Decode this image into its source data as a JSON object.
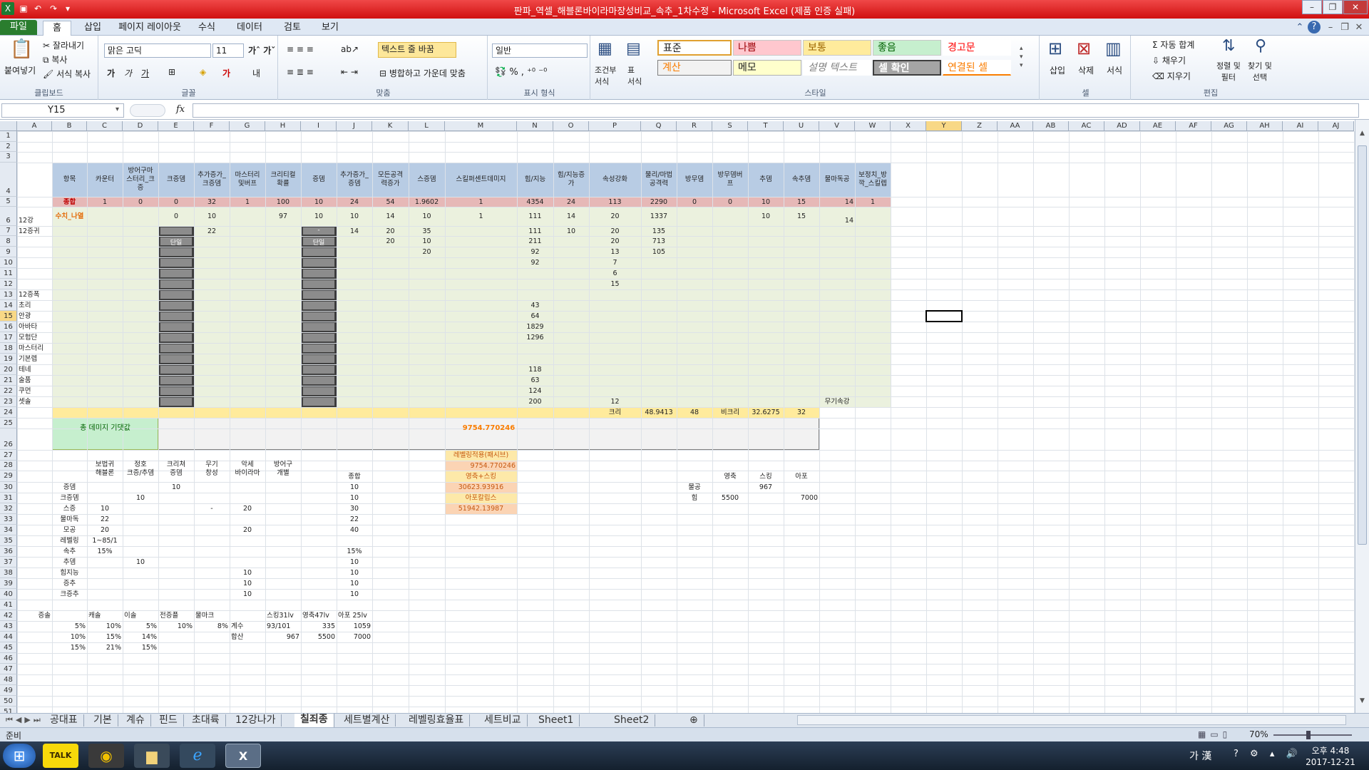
{
  "window": {
    "title": "판파_역셀_해블론바이라마장성비교_속추_1차수정 - Microsoft Excel (제품 인증 실패)"
  },
  "menu": {
    "tabs": [
      "파일",
      "홈",
      "삽입",
      "페이지 레이아웃",
      "수식",
      "데이터",
      "검토",
      "보기"
    ]
  },
  "ribbon": {
    "clipboard": {
      "paste": "붙여넣기",
      "cut": "잘라내기",
      "copy": "복사",
      "format_painter": "서식 복사",
      "label": "클립보드"
    },
    "font": {
      "name": "맑은 고딕",
      "size": "11",
      "label": "글꼴"
    },
    "align": {
      "wrap": "텍스트 줄 바꿈",
      "merge": "병합하고 가운데 맞춤",
      "label": "맞춤"
    },
    "number": {
      "format": "일반",
      "label": "표시 형식"
    },
    "styles": {
      "cond": "조건부\n서식",
      "table": "표\n서식",
      "label": "스타일",
      "cells": [
        "표준",
        "나쁨",
        "보통",
        "좋음",
        "경고문",
        "계산",
        "메모",
        "설명 텍스트",
        "셀 확인",
        "연결된 셀"
      ]
    },
    "cells": {
      "insert": "삽입",
      "delete": "삭제",
      "format": "서식",
      "label": "셀"
    },
    "edit": {
      "autosum": "자동 합계",
      "fill": "채우기",
      "clear": "지우기",
      "sort": "정렬 및\n필터",
      "find": "찾기 및\n선택",
      "label": "편집"
    }
  },
  "formula": {
    "name_box": "Y15",
    "fx": "fx",
    "content": ""
  },
  "columns": [
    "A",
    "B",
    "C",
    "D",
    "E",
    "F",
    "G",
    "H",
    "I",
    "J",
    "K",
    "L",
    "M",
    "N",
    "O",
    "P",
    "Q",
    "R",
    "S",
    "T",
    "U",
    "V",
    "W",
    "X",
    "Y",
    "Z",
    "AA",
    "AB",
    "AC",
    "AD",
    "AE",
    "AF",
    "AG",
    "AH",
    "AI",
    "AJ"
  ],
  "rows": [
    "1",
    "2",
    "3",
    "4",
    "5",
    "6",
    "7",
    "8",
    "9",
    "10",
    "11",
    "12",
    "13",
    "14",
    "15",
    "16",
    "17",
    "18",
    "19",
    "20",
    "21",
    "22",
    "23",
    "24",
    "25",
    "26",
    "27",
    "28",
    "29",
    "30",
    "31",
    "32",
    "33",
    "34",
    "35",
    "36",
    "37",
    "38",
    "39",
    "40",
    "41",
    "42",
    "43",
    "44",
    "45",
    "46",
    "47",
    "48",
    "49",
    "50",
    "51"
  ],
  "grey_labels": {
    "e": "단일",
    "i_top": "-",
    "i": "단일"
  },
  "cells": [
    {
      "c": "B",
      "r": 4,
      "t": "항목"
    },
    {
      "c": "C",
      "r": 4,
      "t": "카운터"
    },
    {
      "c": "D",
      "r": 4,
      "t": "방어구마\n스터리_크\n증"
    },
    {
      "c": "E",
      "r": 4,
      "t": "크증뎀"
    },
    {
      "c": "F",
      "r": 4,
      "t": "추가증가_\n크증뎀"
    },
    {
      "c": "G",
      "r": 4,
      "t": "마스터리\n및버프"
    },
    {
      "c": "H",
      "r": 4,
      "t": "크리티컬\n확률"
    },
    {
      "c": "I",
      "r": 4,
      "t": "증뎀"
    },
    {
      "c": "J",
      "r": 4,
      "t": "추가증가_\n증뎀"
    },
    {
      "c": "K",
      "r": 4,
      "t": "모든공격\n력증가"
    },
    {
      "c": "L",
      "r": 4,
      "t": "스증뎀"
    },
    {
      "c": "M",
      "r": 4,
      "t": "스킬퍼센트데미지"
    },
    {
      "c": "N",
      "r": 4,
      "t": "힘/지능"
    },
    {
      "c": "O",
      "r": 4,
      "t": "힘/지능증\n가"
    },
    {
      "c": "P",
      "r": 4,
      "t": "속성강화"
    },
    {
      "c": "Q",
      "r": 4,
      "t": "물리/마법\n공격력"
    },
    {
      "c": "R",
      "r": 4,
      "t": "방무뎀"
    },
    {
      "c": "S",
      "r": 4,
      "t": "방무뎀버\n프"
    },
    {
      "c": "T",
      "r": 4,
      "t": "추뎀"
    },
    {
      "c": "U",
      "r": 4,
      "t": "속추뎀"
    },
    {
      "c": "V",
      "r": 4,
      "t": "물마독공"
    },
    {
      "c": "W",
      "r": 4,
      "t": "보정치_방\n깍_스킬렙"
    },
    {
      "c": "B",
      "r": 5,
      "t": "종합",
      "cls": "red"
    },
    {
      "c": "C",
      "r": 5,
      "t": "1"
    },
    {
      "c": "D",
      "r": 5,
      "t": "0"
    },
    {
      "c": "E",
      "r": 5,
      "t": "0"
    },
    {
      "c": "F",
      "r": 5,
      "t": "32"
    },
    {
      "c": "G",
      "r": 5,
      "t": "1"
    },
    {
      "c": "H",
      "r": 5,
      "t": "100"
    },
    {
      "c": "I",
      "r": 5,
      "t": "10"
    },
    {
      "c": "J",
      "r": 5,
      "t": "24"
    },
    {
      "c": "K",
      "r": 5,
      "t": "54"
    },
    {
      "c": "L",
      "r": 5,
      "t": "1.9602"
    },
    {
      "c": "M",
      "r": 5,
      "t": "1"
    },
    {
      "c": "N",
      "r": 5,
      "t": "4354"
    },
    {
      "c": "O",
      "r": 5,
      "t": "24"
    },
    {
      "c": "P",
      "r": 5,
      "t": "113"
    },
    {
      "c": "Q",
      "r": 5,
      "t": "2290"
    },
    {
      "c": "R",
      "r": 5,
      "t": "0"
    },
    {
      "c": "S",
      "r": 5,
      "t": "0"
    },
    {
      "c": "T",
      "r": 5,
      "t": "10"
    },
    {
      "c": "U",
      "r": 5,
      "t": "15"
    },
    {
      "c": "V",
      "r": 5,
      "t": "14",
      "a": "r"
    },
    {
      "c": "W",
      "r": 5,
      "t": "1"
    },
    {
      "c": "B",
      "r": 6,
      "t": "수치_나열",
      "cls": "orange"
    },
    {
      "c": "E",
      "r": 6,
      "t": "0"
    },
    {
      "c": "F",
      "r": 6,
      "t": "10"
    },
    {
      "c": "H",
      "r": 6,
      "t": "97"
    },
    {
      "c": "I",
      "r": 6,
      "t": "10"
    },
    {
      "c": "J",
      "r": 6,
      "t": "10"
    },
    {
      "c": "K",
      "r": 6,
      "t": "14"
    },
    {
      "c": "L",
      "r": 6,
      "t": "10"
    },
    {
      "c": "M",
      "r": 6,
      "t": "1"
    },
    {
      "c": "N",
      "r": 6,
      "t": "111"
    },
    {
      "c": "O",
      "r": 6,
      "t": "14"
    },
    {
      "c": "P",
      "r": 6,
      "t": "20"
    },
    {
      "c": "Q",
      "r": 6,
      "t": "1337"
    },
    {
      "c": "T",
      "r": 6,
      "t": "10"
    },
    {
      "c": "U",
      "r": 6,
      "t": "15"
    },
    {
      "c": "A",
      "r": 6,
      "t": "12강",
      "a": "l",
      "low": true
    },
    {
      "c": "V",
      "r": 6,
      "t": "14",
      "a": "r",
      "low": true
    },
    {
      "c": "A",
      "r": 7,
      "t": "12증귀",
      "a": "l"
    },
    {
      "c": "F",
      "r": 7,
      "t": "22"
    },
    {
      "c": "J",
      "r": 7,
      "t": "14"
    },
    {
      "c": "K",
      "r": 7,
      "t": "20"
    },
    {
      "c": "L",
      "r": 7,
      "t": "35"
    },
    {
      "c": "N",
      "r": 7,
      "t": "111"
    },
    {
      "c": "O",
      "r": 7,
      "t": "10"
    },
    {
      "c": "P",
      "r": 7,
      "t": "20"
    },
    {
      "c": "Q",
      "r": 7,
      "t": "135"
    },
    {
      "c": "K",
      "r": 8,
      "t": "20"
    },
    {
      "c": "L",
      "r": 8,
      "t": "10"
    },
    {
      "c": "N",
      "r": 8,
      "t": "211"
    },
    {
      "c": "P",
      "r": 8,
      "t": "20"
    },
    {
      "c": "Q",
      "r": 8,
      "t": "713"
    },
    {
      "c": "L",
      "r": 9,
      "t": "20"
    },
    {
      "c": "N",
      "r": 9,
      "t": "92"
    },
    {
      "c": "P",
      "r": 9,
      "t": "13"
    },
    {
      "c": "Q",
      "r": 9,
      "t": "105"
    },
    {
      "c": "N",
      "r": 10,
      "t": "92"
    },
    {
      "c": "P",
      "r": 10,
      "t": "7"
    },
    {
      "c": "P",
      "r": 11,
      "t": "6"
    },
    {
      "c": "P",
      "r": 12,
      "t": "15"
    },
    {
      "c": "A",
      "r": 13,
      "t": "12증폭",
      "a": "l"
    },
    {
      "c": "A",
      "r": 14,
      "t": "초리",
      "a": "l"
    },
    {
      "c": "N",
      "r": 14,
      "t": "43"
    },
    {
      "c": "A",
      "r": 15,
      "t": "안광",
      "a": "l"
    },
    {
      "c": "N",
      "r": 15,
      "t": "64"
    },
    {
      "c": "A",
      "r": 16,
      "t": "아바타",
      "a": "l"
    },
    {
      "c": "N",
      "r": 16,
      "t": "1829"
    },
    {
      "c": "A",
      "r": 17,
      "t": "모험단",
      "a": "l"
    },
    {
      "c": "N",
      "r": 17,
      "t": "1296"
    },
    {
      "c": "A",
      "r": 18,
      "t": "마스터리",
      "a": "l"
    },
    {
      "c": "A",
      "r": 19,
      "t": "기본렙",
      "a": "l"
    },
    {
      "c": "A",
      "r": 20,
      "t": "테네",
      "a": "l"
    },
    {
      "c": "N",
      "r": 20,
      "t": "118"
    },
    {
      "c": "A",
      "r": 21,
      "t": "술품",
      "a": "l"
    },
    {
      "c": "N",
      "r": 21,
      "t": "63"
    },
    {
      "c": "A",
      "r": 22,
      "t": "쿠먼",
      "a": "l"
    },
    {
      "c": "N",
      "r": 22,
      "t": "124"
    },
    {
      "c": "A",
      "r": 23,
      "t": "셋솔",
      "a": "l"
    },
    {
      "c": "N",
      "r": 23,
      "t": "200"
    },
    {
      "c": "P",
      "r": 23,
      "t": "12"
    },
    {
      "c": "V",
      "r": 23,
      "t": "무기속강"
    },
    {
      "c": "P",
      "r": 24,
      "t": "크리"
    },
    {
      "c": "Q",
      "r": 24,
      "t": "48.9413"
    },
    {
      "c": "R",
      "r": 24,
      "t": "48"
    },
    {
      "c": "S",
      "r": 24,
      "t": "비크리"
    },
    {
      "c": "T",
      "r": 24,
      "t": "32.6275"
    },
    {
      "c": "U",
      "r": 24,
      "t": "32"
    },
    {
      "c": "M",
      "r": 27,
      "t": "레벨링적용(패시브)"
    },
    {
      "c": "M",
      "r": 28,
      "t": "9754.770246",
      "a": "r"
    },
    {
      "c": "M",
      "r": 29,
      "t": "영축+스킹"
    },
    {
      "c": "M",
      "r": 30,
      "t": "30623.93916"
    },
    {
      "c": "M",
      "r": 31,
      "t": "아포칼립스"
    },
    {
      "c": "M",
      "r": 32,
      "t": "51942.13987"
    },
    {
      "c": "C",
      "r": 28,
      "t": "보법귀\n해블론"
    },
    {
      "c": "D",
      "r": 28,
      "t": "정호\n크증/추뎀"
    },
    {
      "c": "E",
      "r": 28,
      "t": "크리쳐\n증뎀"
    },
    {
      "c": "F",
      "r": 28,
      "t": "무기\n창성"
    },
    {
      "c": "G",
      "r": 28,
      "t": "악세\n바이라마"
    },
    {
      "c": "H",
      "r": 28,
      "t": "방어구\n개별"
    },
    {
      "c": "J",
      "r": 29,
      "t": "종합"
    },
    {
      "c": "B",
      "r": 30,
      "t": "증뎀"
    },
    {
      "c": "E",
      "r": 30,
      "t": "10"
    },
    {
      "c": "J",
      "r": 30,
      "t": "10"
    },
    {
      "c": "B",
      "r": 31,
      "t": "크증뎀"
    },
    {
      "c": "D",
      "r": 31,
      "t": "10"
    },
    {
      "c": "J",
      "r": 31,
      "t": "10"
    },
    {
      "c": "B",
      "r": 32,
      "t": "스증"
    },
    {
      "c": "C",
      "r": 32,
      "t": "10"
    },
    {
      "c": "F",
      "r": 32,
      "t": "-"
    },
    {
      "c": "G",
      "r": 32,
      "t": "20"
    },
    {
      "c": "J",
      "r": 32,
      "t": "30"
    },
    {
      "c": "B",
      "r": 33,
      "t": "물마독"
    },
    {
      "c": "C",
      "r": 33,
      "t": "22"
    },
    {
      "c": "J",
      "r": 33,
      "t": "22"
    },
    {
      "c": "B",
      "r": 34,
      "t": "모공"
    },
    {
      "c": "C",
      "r": 34,
      "t": "20"
    },
    {
      "c": "G",
      "r": 34,
      "t": "20"
    },
    {
      "c": "J",
      "r": 34,
      "t": "40"
    },
    {
      "c": "B",
      "r": 35,
      "t": "레벨링"
    },
    {
      "c": "C",
      "r": 35,
      "t": "1~85/1"
    },
    {
      "c": "B",
      "r": 36,
      "t": "속추"
    },
    {
      "c": "C",
      "r": 36,
      "t": "15%"
    },
    {
      "c": "J",
      "r": 36,
      "t": "15%"
    },
    {
      "c": "B",
      "r": 37,
      "t": "추뎀"
    },
    {
      "c": "D",
      "r": 37,
      "t": "10"
    },
    {
      "c": "J",
      "r": 37,
      "t": "10"
    },
    {
      "c": "B",
      "r": 38,
      "t": "힘지능"
    },
    {
      "c": "G",
      "r": 38,
      "t": "10"
    },
    {
      "c": "J",
      "r": 38,
      "t": "10"
    },
    {
      "c": "B",
      "r": 39,
      "t": "증추"
    },
    {
      "c": "G",
      "r": 39,
      "t": "10"
    },
    {
      "c": "J",
      "r": 39,
      "t": "10"
    },
    {
      "c": "B",
      "r": 40,
      "t": "크증추"
    },
    {
      "c": "G",
      "r": 40,
      "t": "10"
    },
    {
      "c": "J",
      "r": 40,
      "t": "10"
    },
    {
      "c": "S",
      "r": 29,
      "t": "영축"
    },
    {
      "c": "T",
      "r": 29,
      "t": "스킹"
    },
    {
      "c": "U",
      "r": 29,
      "t": "아포"
    },
    {
      "c": "R",
      "r": 30,
      "t": "물공"
    },
    {
      "c": "T",
      "r": 30,
      "t": "967"
    },
    {
      "c": "R",
      "r": 31,
      "t": "힘"
    },
    {
      "c": "S",
      "r": 31,
      "t": "5500"
    },
    {
      "c": "U",
      "r": 31,
      "t": "7000",
      "a": "r"
    },
    {
      "c": "A",
      "r": 42,
      "t": "증솔",
      "a": "r"
    },
    {
      "c": "C",
      "r": 42,
      "t": "캐솔",
      "a": "l"
    },
    {
      "c": "D",
      "r": 42,
      "t": "이솔",
      "a": "l"
    },
    {
      "c": "E",
      "r": 42,
      "t": "전증플",
      "a": "l"
    },
    {
      "c": "F",
      "r": 42,
      "t": "물마크",
      "a": "l"
    },
    {
      "c": "H",
      "r": 42,
      "t": "스킹31lv",
      "a": "l"
    },
    {
      "c": "I",
      "r": 42,
      "t": "영축47lv",
      "a": "l"
    },
    {
      "c": "J",
      "r": 42,
      "t": "아포 25lv",
      "a": "l"
    },
    {
      "c": "B",
      "r": 43,
      "t": "5%",
      "a": "r"
    },
    {
      "c": "C",
      "r": 43,
      "t": "10%",
      "a": "r"
    },
    {
      "c": "D",
      "r": 43,
      "t": "5%",
      "a": "r"
    },
    {
      "c": "E",
      "r": 43,
      "t": "10%",
      "a": "r"
    },
    {
      "c": "F",
      "r": 43,
      "t": "8%",
      "a": "r"
    },
    {
      "c": "G",
      "r": 43,
      "t": "계수",
      "a": "l"
    },
    {
      "c": "H",
      "r": 43,
      "t": "93/101",
      "a": "l"
    },
    {
      "c": "I",
      "r": 43,
      "t": "335",
      "a": "r"
    },
    {
      "c": "J",
      "r": 43,
      "t": "1059",
      "a": "r"
    },
    {
      "c": "B",
      "r": 44,
      "t": "10%",
      "a": "r"
    },
    {
      "c": "C",
      "r": 44,
      "t": "15%",
      "a": "r"
    },
    {
      "c": "D",
      "r": 44,
      "t": "14%",
      "a": "r"
    },
    {
      "c": "G",
      "r": 44,
      "t": "합산",
      "a": "l"
    },
    {
      "c": "H",
      "r": 44,
      "t": "967",
      "a": "r"
    },
    {
      "c": "I",
      "r": 44,
      "t": "5500",
      "a": "r"
    },
    {
      "c": "J",
      "r": 44,
      "t": "7000",
      "a": "r"
    },
    {
      "c": "B",
      "r": 45,
      "t": "15%",
      "a": "r"
    },
    {
      "c": "C",
      "r": 45,
      "t": "21%",
      "a": "r"
    },
    {
      "c": "D",
      "r": 45,
      "t": "15%",
      "a": "r"
    }
  ],
  "total_damage": {
    "label": "총 데미지 기댓값",
    "value": "9754.770246"
  },
  "sheets": [
    "공대표",
    "기본",
    "계슈",
    "핀드",
    "초대륙",
    "12강나가",
    "칠죄종",
    "세트별계산",
    "레벨링효율표",
    "세트비교",
    "Sheet1",
    "Sheet2"
  ],
  "active_sheet": "칠죄종",
  "status": {
    "ready": "준비",
    "zoom": "70%"
  },
  "taskbar": {
    "ime": "가 漢",
    "time": "오후 4:48",
    "date": "2017-12-21",
    "kakao": "TALK"
  },
  "colors": {
    "header_blue": "#b8cce4",
    "total_red": "#e6b8b7",
    "green_fill": "#ebf1de",
    "yellow_band": "#ffeb9c",
    "orange_text": "#e46c0a",
    "calc_fill": "#fbd4b4"
  }
}
